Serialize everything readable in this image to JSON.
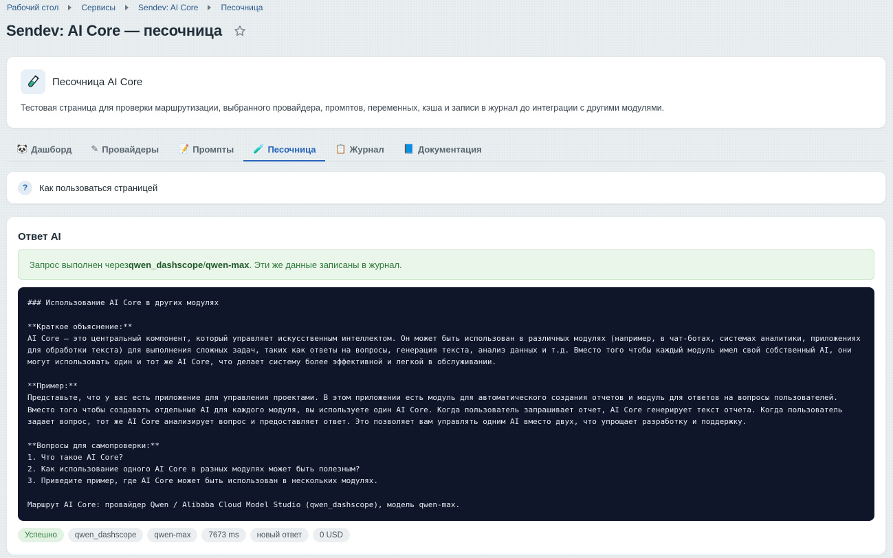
{
  "breadcrumb": [
    "Рабочий стол",
    "Сервисы",
    "Sendev: AI Core",
    "Песочница"
  ],
  "page": {
    "title": "Sendev: AI Core — песочница",
    "favorite_icon": "star-icon"
  },
  "intro": {
    "icon": "test-tube-icon",
    "title": "Песочница AI Core",
    "description": "Тестовая страница для проверки маршрутизации, выбранного провайдера, промптов, переменных, кэша и записи в журнал до интеграции с другими модулями."
  },
  "tabs": [
    {
      "icon": "🐼",
      "label": "Дашборд",
      "active": false
    },
    {
      "icon": "✎",
      "label": "Провайдеры",
      "active": false
    },
    {
      "icon": "📝",
      "label": "Промпты",
      "active": false
    },
    {
      "icon": "🧪",
      "label": "Песочница",
      "active": true
    },
    {
      "icon": "📋",
      "label": "Журнал",
      "active": false
    },
    {
      "icon": "📘",
      "label": "Документация",
      "active": false
    }
  ],
  "help": {
    "icon": "?",
    "label": "Как пользоваться страницей"
  },
  "answer": {
    "title": "Ответ AI",
    "alert": {
      "prefix": "Запрос выполнен через ",
      "provider": "qwen_dashscope",
      "slash": " / ",
      "model": "qwen-max",
      "suffix": ". Эти же данные записаны в журнал."
    },
    "output": "### Использование AI Core в других модулях\n\n**Краткое объяснение:**\nAI Core — это центральный компонент, который управляет искусственным интеллектом. Он может быть использован в различных модулях (например, в чат-ботах, системах аналитики, приложениях для обработки текста) для выполнения сложных задач, таких как ответы на вопросы, генерация текста, анализ данных и т.д. Вместо того чтобы каждый модуль имел свой собственный AI, они могут использовать один и тот же AI Core, что делает систему более эффективной и легкой в обслуживании.\n\n**Пример:**\nПредставьте, что у вас есть приложение для управления проектами. В этом приложении есть модуль для автоматического создания отчетов и модуль для ответов на вопросы пользователей. Вместо того чтобы создавать отдельные AI для каждого модуля, вы используете один AI Core. Когда пользователь запрашивает отчет, AI Core генерирует текст отчета. Когда пользователь задает вопрос, тот же AI Core анализирует вопрос и предоставляет ответ. Это позволяет вам управлять одним AI вместо двух, что упрощает разработку и поддержку.\n\n**Вопросы для самопроверки:**\n1. Что такое AI Core?\n2. Как использование одного AI Core в разных модулях может быть полезным?\n3. Приведите пример, где AI Core может быть использован в нескольких модулях.\n\nМаршрут AI Core: провайдер Qwen / Alibaba Cloud Model Studio (qwen_dashscope), модель qwen-max.",
    "chips": [
      "Успешно",
      "qwen_dashscope",
      "qwen-max",
      "7673 ms",
      "новый ответ",
      "0 USD"
    ]
  },
  "colors": {
    "accent": "#2563b8",
    "success": "#2f7a3a",
    "code_bg": "#0f1629"
  }
}
